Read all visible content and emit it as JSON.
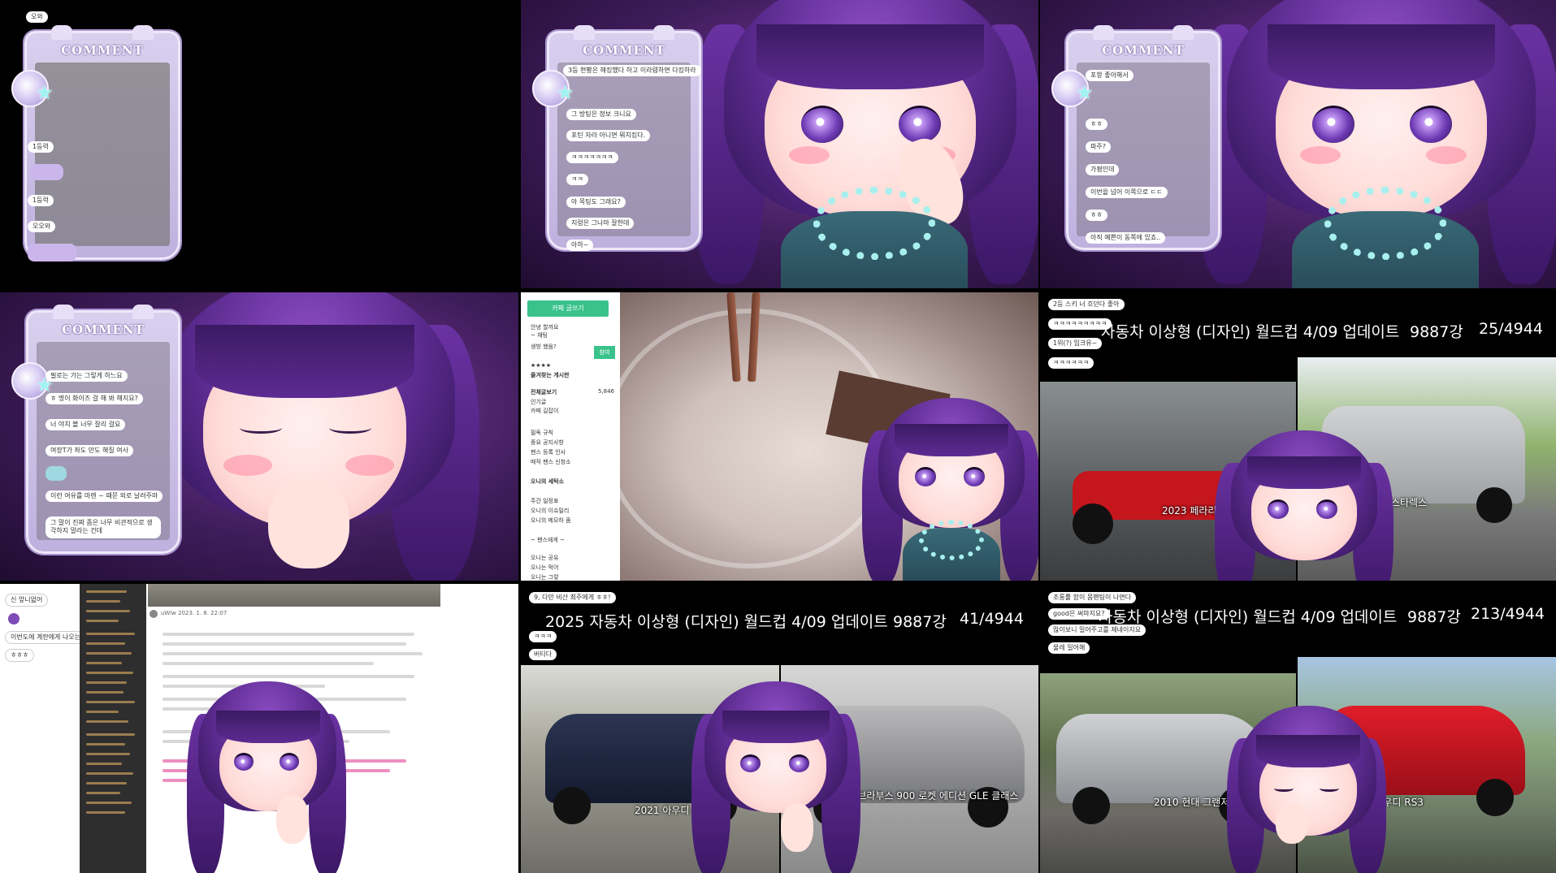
{
  "comment_widget": {
    "title": "COMMENT"
  },
  "panel1": {
    "chat": [
      "오와",
      "1등럭",
      "1등럭",
      "오오와"
    ]
  },
  "panel2": {
    "chat": [
      "3등 현황은 해킹했다 하고 이라렴하면 다킹하라",
      "그 방팅은 정보 크니요",
      "포틴 자라 아니면 뭐치킹다.",
      "ㅋㅋㅋㅋㅋㅋㅋ",
      "ㅋㅋ",
      "아 목팅도 그래요?",
      "지렁은 그나마 잘한데",
      "아하~"
    ]
  },
  "panel3": {
    "chat": [
      "포항 좋아해서",
      "ㅎㅎ",
      "파주?",
      "가평인데",
      "이번을 넘어 이쪽으로 ㄷㄷ",
      "ㅎㅎ",
      "아직 예쁜이 동쪽에 있죠.."
    ]
  },
  "panel4": {
    "chat": [
      "필로는 가는 그렇게 하느요",
      "ㅎ 명이 화이즈 걸 해 봐 해지요?",
      "너 야치 볼 너무 잘리 걸요",
      "여장T가 좌도 만도 해질 여사",
      "이런 여유를 마렌 ~ 때문 외로 날려주마",
      "그 말이 진짜 좀은 너무 비관적으로 생각하지 말라는 건데"
    ]
  },
  "panel5": {
    "sidebar": {
      "write_button": "카페 글쓰기",
      "lines": [
        "안녕 할까요",
        "~ 채팅",
        "생방 했음?",
        "★★★★",
        "즐겨찾는 게시판",
        "전체글보기",
        "5,846",
        "인기글",
        "카페 길잡이",
        "필독 규칙",
        "중요 공지사항",
        "팬스 등록 인사",
        "매작 팬스 신청소",
        "오니의 세탁소",
        "주간 일정표",
        "오니의 이슈밀리",
        "오니의 메모하 좀",
        "~ 팬스에게 ~",
        "오니는 공유",
        "오니는 먹어",
        "오니는 그렇"
      ],
      "join_button": "참여"
    }
  },
  "panel6": {
    "chat": [
      "2등 스키 너 흐던다 좋아",
      "ㅋㅋㅋㅋㅋㅋㅋㅋㅋ",
      "1위(?) 임크유~",
      "ㅋㅋㅋㅋㅋㅋ"
    ],
    "header": {
      "title": "자동차 이상형 (디자인) 월드컵 4/09 업데이트",
      "count": "9887강",
      "progress": "25/4944"
    },
    "left_caption": "2023 페라리 SF",
    "right_caption": "03 현대 스타렉스"
  },
  "panel7": {
    "chat": [
      "신 앞니없어",
      "이번도에 계란에게 나오는데 바람에",
      "ㅎㅎㅎ"
    ],
    "blog_author": "uWiw  2023. 1. 8. 22:07"
  },
  "panel8": {
    "chat": [
      "9, 다만 비산 최주에게 ㅎㅎ!",
      "ㅋㅋㅋ",
      "버티다"
    ],
    "header": {
      "title": "2025 자동차 이상형 (디자인) 월드컵 4/09 업데이트",
      "count": "9887강",
      "progress": "41/4944"
    },
    "left_caption": "2021 아우디 e-트론",
    "right_caption": "2021 브라부스 900 로켓 에디션 GLE 클래스"
  },
  "panel9": {
    "chat": [
      "조롱률 함이 몸팬팅이 나면다",
      "good은 써마지요?",
      "많이보니 밀어주고를 제네이지요",
      "물레 밀어해"
    ],
    "header": {
      "title": "자동차 이상형 (디자인) 월드컵 4/09 업데이트",
      "count": "9887강",
      "progress": "213/4944"
    },
    "left_caption": "2010 현대 그랜저 TG",
    "right_caption": "2018 아우디 RS3"
  },
  "colors": {
    "accent_green": "#39c28a",
    "widget_lilac": "#d9d0ee",
    "hair_purple": "#5a2a8e"
  }
}
